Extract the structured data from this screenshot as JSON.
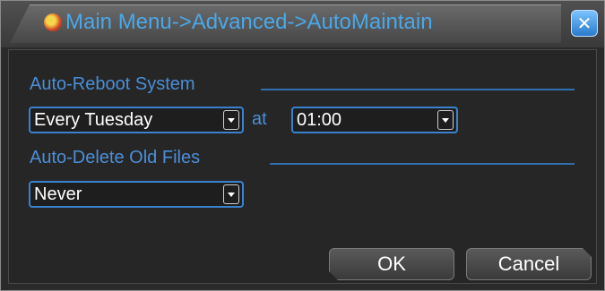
{
  "window": {
    "title": "Main Menu->Advanced->AutoMaintain",
    "close_icon": "close-icon"
  },
  "auto_reboot": {
    "label": "Auto-Reboot System",
    "day": "Every Tuesday",
    "at_label": "at",
    "time": "01:00"
  },
  "auto_delete": {
    "label": "Auto-Delete Old Files",
    "value": "Never"
  },
  "buttons": {
    "ok": "OK",
    "cancel": "Cancel"
  },
  "colors": {
    "accent": "#4a8fd8",
    "title": "#4aa8e8",
    "background": "#262626"
  }
}
